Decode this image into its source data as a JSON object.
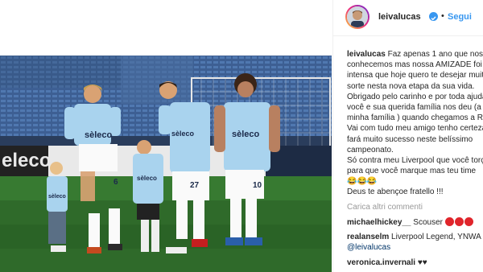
{
  "header": {
    "username": "leivalucas",
    "dot": "•",
    "follow_label": "Segui"
  },
  "caption": {
    "author": "leivalucas",
    "lines": [
      "Faz apenas 1 ano que nos",
      "conhecemos mas nossa AMIZADE foi tão",
      "intensa que hoje quero te desejar muita",
      "sorte nesta nova etapa da sua vida.",
      "Obrigado pelo carinho e por toda ajuda,",
      "você e sua querida família nos deu (a",
      "minha família ) quando chegamos a Roma",
      "Vai com tudo meu amigo tenho certeza",
      "fará muito sucesso neste belíssimo",
      "campeonato.",
      "Só contra meu Liverpool que você torça",
      "para que você marque mas teu time",
      "😂😂😂",
      "Deus te abençoe fratello !!!"
    ]
  },
  "load_more_label": "Carica altri commenti",
  "comments": [
    {
      "user": "michaelhickey__",
      "text": " Scouser "
    },
    {
      "user": "realanselm",
      "text": " Liverpool Legend, YNWA"
    },
    {
      "mention": "@leivalucas"
    },
    {
      "user": "veronica.invernali",
      "text": " ♥♥"
    }
  ],
  "photo": {
    "banner_text": "eleco",
    "shirt_sponsor": "sèleco",
    "numbers": [
      "6",
      "27",
      "10"
    ]
  },
  "colors": {
    "link": "#3897f0",
    "mention": "#003569",
    "pitch": "#2f6a2a",
    "kit": "#a9d3ee"
  }
}
